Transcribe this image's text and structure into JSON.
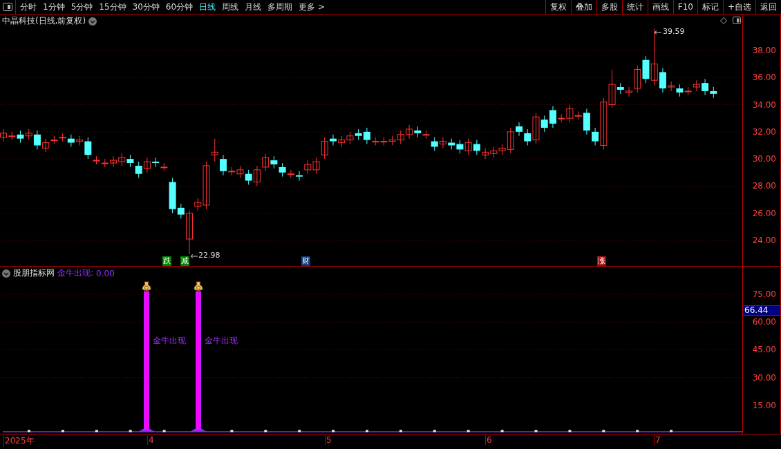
{
  "toolbar": {
    "periods": [
      {
        "label": "分时",
        "selected": false
      },
      {
        "label": "1分钟",
        "selected": false
      },
      {
        "label": "5分钟",
        "selected": false
      },
      {
        "label": "15分钟",
        "selected": false
      },
      {
        "label": "30分钟",
        "selected": false
      },
      {
        "label": "60分钟",
        "selected": false
      },
      {
        "label": "日线",
        "selected": true
      },
      {
        "label": "周线",
        "selected": false
      },
      {
        "label": "月线",
        "selected": false
      },
      {
        "label": "多周期",
        "selected": false
      },
      {
        "label": "更多 >",
        "selected": false
      }
    ],
    "buttons": [
      "复权",
      "叠加",
      "多股",
      "统计",
      "画线",
      "F10",
      "标记",
      "+自选",
      "返回"
    ]
  },
  "main_chart": {
    "title": "中晶科技(日线,前复权)",
    "high_label": "39.59",
    "low_label": "22.98",
    "markers": [
      {
        "label": "跌",
        "color": "#008000"
      },
      {
        "label": "减",
        "color": "#008000"
      },
      {
        "label": "财",
        "color": "#0a3a78"
      },
      {
        "label": "涨",
        "color": "#a01010"
      }
    ],
    "price_ticks": [
      "38.00",
      "36.00",
      "34.00",
      "32.00",
      "30.00",
      "28.00",
      "26.00",
      "24.00"
    ]
  },
  "indicator": {
    "name": "股朋指标网",
    "line_label": "金牛出现:",
    "line_value": "0.00",
    "signals": [
      "金牛出现",
      "金牛出现"
    ],
    "ticks": [
      "75.00",
      "60.00",
      "45.00",
      "30.00",
      "15.00"
    ],
    "current_value": "66.44"
  },
  "date_axis": [
    "2025年",
    "4",
    "5",
    "6",
    "7"
  ]
}
